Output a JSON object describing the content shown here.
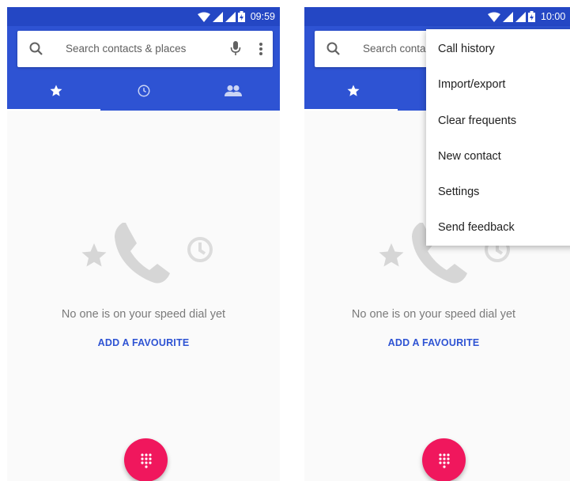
{
  "left": {
    "status": {
      "time": "09:59"
    },
    "search": {
      "placeholder": "Search contacts & places"
    },
    "tabs": [
      {
        "icon": "star-icon",
        "selected": true
      },
      {
        "icon": "clock-icon",
        "selected": false
      },
      {
        "icon": "people-icon",
        "selected": false
      }
    ],
    "empty_state": {
      "message": "No one is on your speed dial yet",
      "action": "ADD A FAVOURITE"
    }
  },
  "right": {
    "status": {
      "time": "10:00"
    },
    "search": {
      "placeholder": "Search conta"
    },
    "tabs": [
      {
        "icon": "star-icon",
        "selected": true
      }
    ],
    "menu": {
      "items": [
        "Call history",
        "Import/export",
        "Clear frequents",
        "New contact",
        "Settings",
        "Send feedback"
      ]
    },
    "empty_state": {
      "message": "No one is on your speed dial yet",
      "action": "ADD A FAVOURITE"
    }
  },
  "colors": {
    "status_bar": "#2447c4",
    "app_bar": "#2e53d3",
    "accent": "#f0175d",
    "link": "#2e53d3"
  }
}
